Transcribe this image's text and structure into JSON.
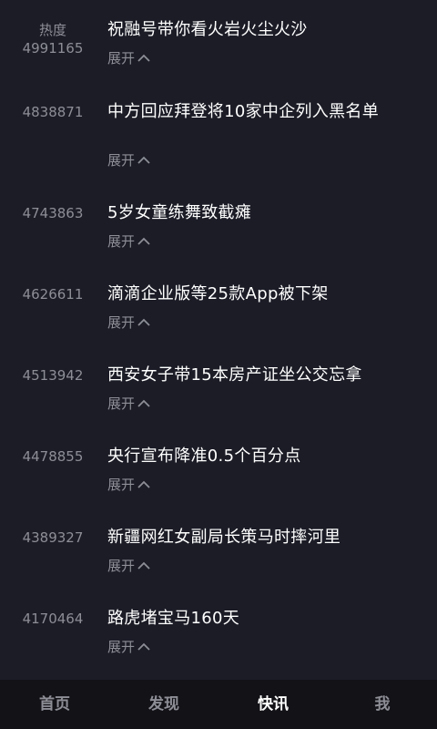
{
  "list": {
    "heat_header": "热度",
    "expand_label": "展开",
    "items": [
      {
        "heat": "4991165",
        "title": "祝融号带你看火岩火尘火沙"
      },
      {
        "heat": "4838871",
        "title": "中方回应拜登将10家中企列入黑名单"
      },
      {
        "heat": "4743863",
        "title": "5岁女童练舞致截瘫"
      },
      {
        "heat": "4626611",
        "title": "滴滴企业版等25款App被下架"
      },
      {
        "heat": "4513942",
        "title": "西安女子带15本房产证坐公交忘拿"
      },
      {
        "heat": "4478855",
        "title": "央行宣布降准0.5个百分点"
      },
      {
        "heat": "4389327",
        "title": "新疆网红女副局长策马时摔河里"
      },
      {
        "heat": "4170464",
        "title": "路虎堵宝马160天"
      }
    ]
  },
  "tabbar": {
    "tabs": [
      "首页",
      "发现",
      "快讯",
      "我"
    ],
    "active": "快讯"
  }
}
